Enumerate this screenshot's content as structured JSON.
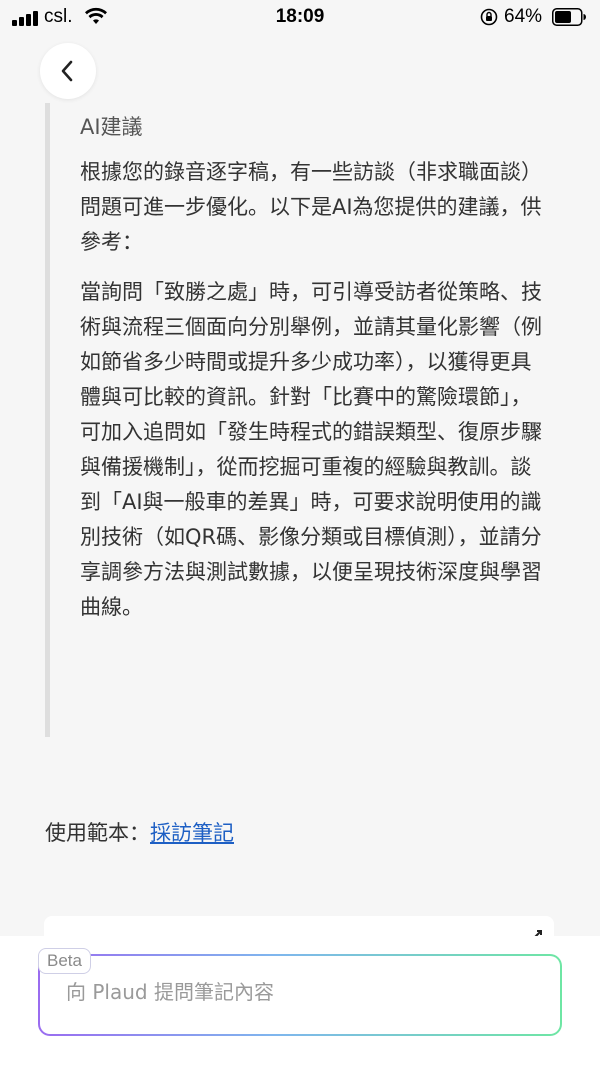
{
  "status_bar": {
    "carrier": "csl.",
    "time": "18:09",
    "battery_percent": "64%",
    "battery_level": 0.64
  },
  "nav": {
    "back_icon": "chevron-left-icon"
  },
  "ai_suggestion": {
    "title": "AI建議",
    "intro": "根據您的錄音逐字稿，有一些訪談（非求職面談）問題可進一步優化。以下是AI為您提供的建議，供參考：",
    "body": "當詢問「致勝之處」時，可引導受訪者從策略、技術與流程三個面向分別舉例，並請其量化影響（例如節省多少時間或提升多少成功率），以獲得更具體與可比較的資訊。針對「比賽中的驚險環節」，可加入追問如「發生時程式的錯誤類型、復原步驟與備援機制」，從而挖掘可重複的經驗與教訓。談到「AI與一般車的差異」時，可要求說明使用的識別技術（如QR碼、影像分類或目標偵測），並請分享調參方法與測試數據，以便呈現技術深度與學習曲線。"
  },
  "template": {
    "label": "使用範本：",
    "link": "採訪筆記"
  },
  "ask": {
    "badge": "Beta",
    "placeholder": "向 Plaud 提問筆記內容"
  },
  "colors": {
    "link": "#1d5fc4",
    "gradient_start": "#9a6cf0",
    "gradient_end": "#6ee6a4"
  }
}
